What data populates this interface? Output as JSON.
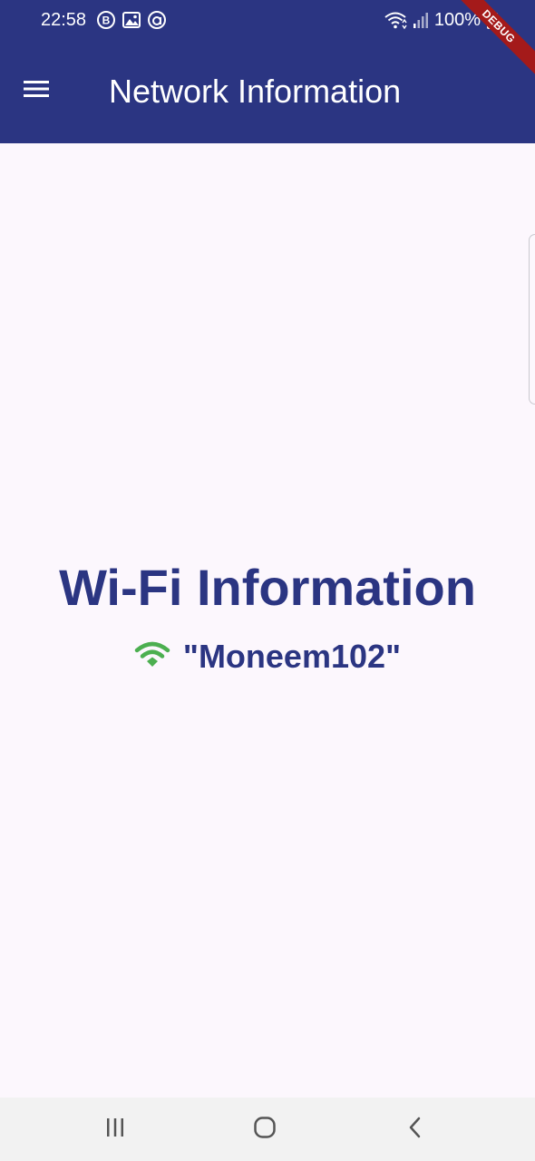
{
  "status_bar": {
    "time": "22:58",
    "battery": "100%",
    "left_icons": [
      "b-circle-icon",
      "image-icon",
      "a-circle-icon"
    ],
    "right_icons": [
      "wifi-status-icon",
      "signal-icon",
      "battery-icon"
    ]
  },
  "debug_banner": "DEBUG",
  "app_bar": {
    "title": "Network Information",
    "menu_icon": "menu-icon"
  },
  "content": {
    "heading": "Wi-Fi Information",
    "ssid": "\"Moneem102\"",
    "wifi_icon_color": "#4caf50"
  },
  "colors": {
    "primary": "#2b3582",
    "background": "#fcf7fd",
    "nav_bar": "#f2f2f2"
  },
  "nav_bar": {
    "buttons": [
      "recents-icon",
      "home-icon",
      "back-icon"
    ]
  }
}
